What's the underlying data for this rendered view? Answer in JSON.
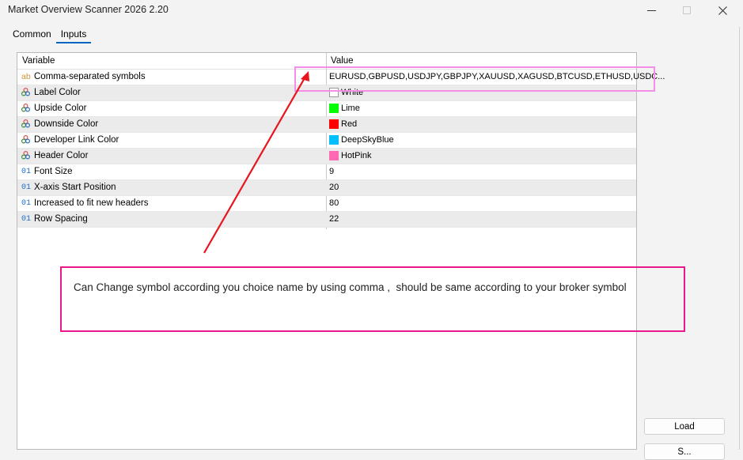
{
  "window": {
    "title": "Market Overview Scanner 2026 2.20"
  },
  "tabs": [
    {
      "label": "Common",
      "active": false
    },
    {
      "label": "Inputs",
      "active": true
    }
  ],
  "grid": {
    "headers": {
      "variable": "Variable",
      "value": "Value"
    },
    "rows": [
      {
        "type": "string",
        "icon": "ab",
        "variable": "Comma-separated symbols",
        "value": "EURUSD,GBPUSD,USDJPY,GBPJPY,XAUUSD,XAGUSD,BTCUSD,ETHUSD,USDC..."
      },
      {
        "type": "color",
        "icon": "palette-icon",
        "variable": "Label Color",
        "value": "White",
        "color": "#ffffff"
      },
      {
        "type": "color",
        "icon": "palette-icon",
        "variable": "Upside Color",
        "value": "Lime",
        "color": "#00ff00"
      },
      {
        "type": "color",
        "icon": "palette-icon",
        "variable": "Downside Color",
        "value": "Red",
        "color": "#ff0000"
      },
      {
        "type": "color",
        "icon": "palette-icon",
        "variable": "Developer Link Color",
        "value": "DeepSkyBlue",
        "color": "#00bfff"
      },
      {
        "type": "color",
        "icon": "palette-icon",
        "variable": "Header Color",
        "value": "HotPink",
        "color": "#ff69b4"
      },
      {
        "type": "int",
        "icon": "01",
        "variable": "Font Size",
        "value": "9"
      },
      {
        "type": "int",
        "icon": "01",
        "variable": "X-axis Start Position",
        "value": "20"
      },
      {
        "type": "int",
        "icon": "01",
        "variable": "Increased to fit new headers",
        "value": "80"
      },
      {
        "type": "int",
        "icon": "01",
        "variable": "Row Spacing",
        "value": "22"
      }
    ]
  },
  "buttons": {
    "load": "Load",
    "save": "S..."
  },
  "annotation": {
    "note": "Can Change symbol according you choice name by using comma ,  should be same according to your broker symbol",
    "box_color_symbols": "#f58ee5",
    "box_color_note": "#e8198c",
    "arrow_color": "#e8141e"
  }
}
